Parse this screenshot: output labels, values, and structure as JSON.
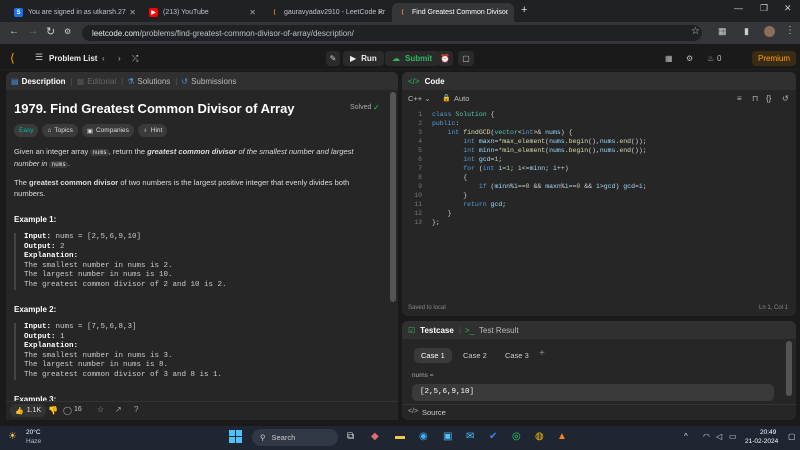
{
  "browser": {
    "tabs": [
      {
        "title": "You are signed in as utkarsh.27",
        "color": "#1a73e8"
      },
      {
        "title": "(213) YouTube",
        "color": "#ff0000"
      },
      {
        "title": "gauravyadav2910 - LeetCode Pr",
        "color": "#ffa116"
      },
      {
        "title": "Find Greatest Common Divisor",
        "color": "#ffa116"
      }
    ],
    "url_domain": "leetcode.com",
    "url_path": "/problems/find-greatest-common-divisor-of-array/description/"
  },
  "lc_nav": {
    "problem_list": "Problem List",
    "run": "Run",
    "submit": "Submit",
    "streak": "0",
    "premium": "Premium"
  },
  "left_tabs": {
    "description": "Description",
    "editorial": "Editorial",
    "solutions": "Solutions",
    "submissions": "Submissions"
  },
  "problem": {
    "title": "1979. Find Greatest Common Divisor of Array",
    "status": "Solved",
    "tags": [
      "Easy",
      "Topics",
      "Companies",
      "Hint"
    ],
    "desc_a": "Given an integer array",
    "desc_code": "nums",
    "desc_b": ", return the",
    "desc_c": "greatest common divisor",
    "desc_d": "of the smallest number and largest number in",
    "desc_e": "nums",
    "desc_f": ".",
    "def_a": "The",
    "def_b": "greatest common divisor",
    "def_c": "of two numbers is the largest positive integer that evenly divides both numbers.",
    "examples": [
      {
        "heading": "Example 1:",
        "input": "nums = [2,5,6,9,10]",
        "output": "2",
        "lines": [
          "The smallest number in nums is 2.",
          "The largest number in nums is 10.",
          "The greatest common divisor of 2 and 10 is 2."
        ]
      },
      {
        "heading": "Example 2:",
        "input": "nums = [7,5,6,8,3]",
        "output": "1",
        "lines": [
          "The smallest number in nums is 3.",
          "The largest number in nums is 8.",
          "The greatest common divisor of 3 and 8 is 1."
        ]
      }
    ],
    "example3_heading": "Example 3:",
    "input_label": "Input:",
    "output_label": "Output:",
    "explanation_label": "Explanation:",
    "likes": "1.1K",
    "comments": "16"
  },
  "code_panel": {
    "title": "Code",
    "language": "C++",
    "mode": "Auto",
    "saved": "Saved to local",
    "cursor": "Ln 1, Col 1"
  },
  "testcase": {
    "tab": "Testcase",
    "result_tab": "Test Result",
    "cases": [
      "Case 1",
      "Case 2",
      "Case 3"
    ],
    "param": "nums =",
    "value": "[2,5,6,9,10]",
    "source": "Source"
  },
  "taskbar": {
    "temp": "20°C",
    "weather": "Haze",
    "search": "Search",
    "time": "20:49",
    "date": "21-02-2024"
  }
}
